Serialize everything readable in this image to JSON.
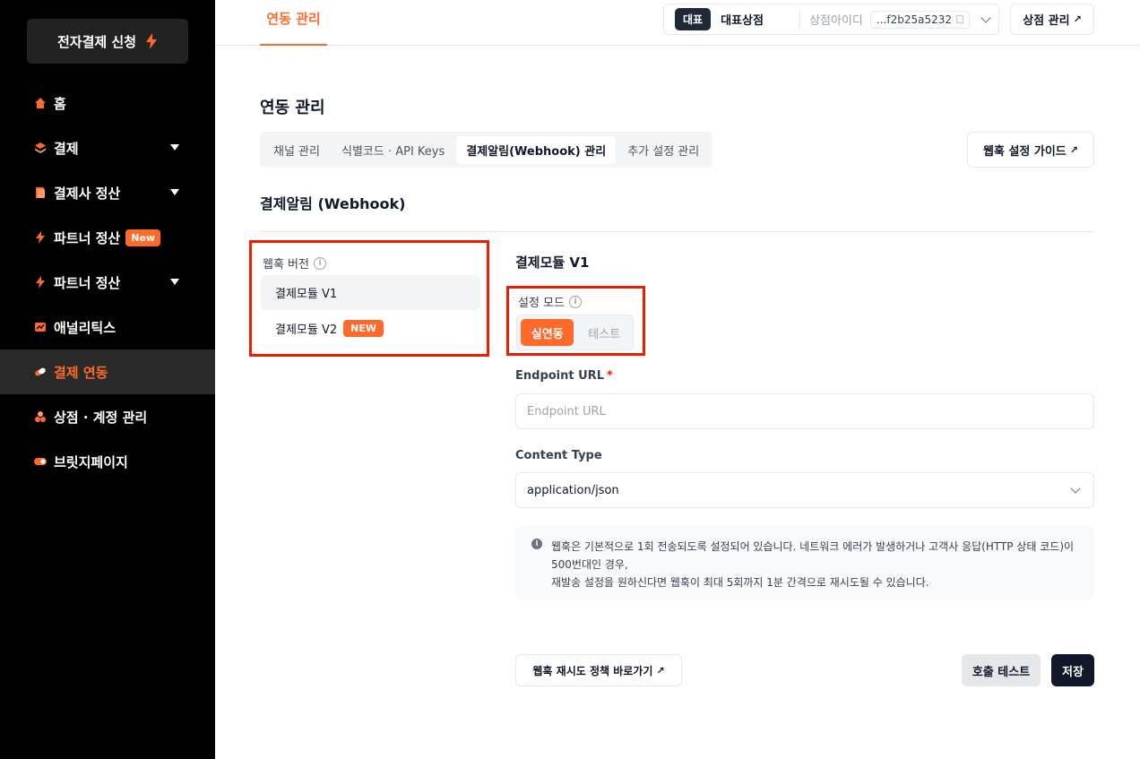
{
  "sidebar": {
    "apply_button": "전자결제 신청",
    "items": [
      {
        "label": "홈",
        "icon": "home-icon"
      },
      {
        "label": "결제",
        "icon": "layers-icon"
      },
      {
        "label": "결제사 정산",
        "icon": "document-icon"
      },
      {
        "label": "파트너 정산",
        "icon": "bolt-icon",
        "badge": "New"
      },
      {
        "label": "파트너 정산",
        "icon": "bolt-icon"
      },
      {
        "label": "애널리틱스",
        "icon": "chart-icon"
      },
      {
        "label": "결제 연동",
        "icon": "link-icon",
        "active": true
      },
      {
        "label": "상점 · 계정 관리",
        "icon": "store-icon"
      },
      {
        "label": "브릿지페이지",
        "icon": "toggle-icon"
      }
    ]
  },
  "topbar": {
    "tab": "연동 관리",
    "rep_badge": "대표",
    "store_name": "대표상점",
    "store_id_label": "상점아이디",
    "store_id": "...f2b25a5232",
    "store_mgmt": "상점 관리"
  },
  "main": {
    "title": "연동 관리",
    "subtabs": [
      "채널 관리",
      "식별코드 · API Keys",
      "결제알림(Webhook) 관리",
      "추가 설정 관리"
    ],
    "guide_button": "웹훅 설정 가이드",
    "section_title": "결제알림 (Webhook)"
  },
  "versions": {
    "label": "웹훅 버전",
    "items": [
      "결제모듈 V1",
      "결제모듈 V2"
    ],
    "new_badge": "NEW"
  },
  "form": {
    "module_title": "결제모듈 V1",
    "mode_label": "설정 모드",
    "mode_on": "실연동",
    "mode_off": "테스트",
    "endpoint_label": "Endpoint URL",
    "endpoint_required": "*",
    "endpoint_placeholder": "Endpoint URL",
    "content_type_label": "Content Type",
    "content_type_value": "application/json",
    "notice_line1": "웹훅은 기본적으로 1회 전송되도록 설정되어 있습니다. 네트워크 에러가 발생하거나 고객사 응답(HTTP 상태 코드)이 500번대인 경우,",
    "notice_line2": "재발송 설정을 원하신다면 웹훅이 최대 5회까지 1분 간격으로 재시도될 수 있습니다.",
    "retry_link": "웹훅 재시도 정책 바로가기",
    "test_button": "호출 테스트",
    "save_button": "저장"
  },
  "colors": {
    "accent": "#ff6a2b",
    "highlight": "#ee1c00",
    "sidebar_bg": "#000000"
  }
}
